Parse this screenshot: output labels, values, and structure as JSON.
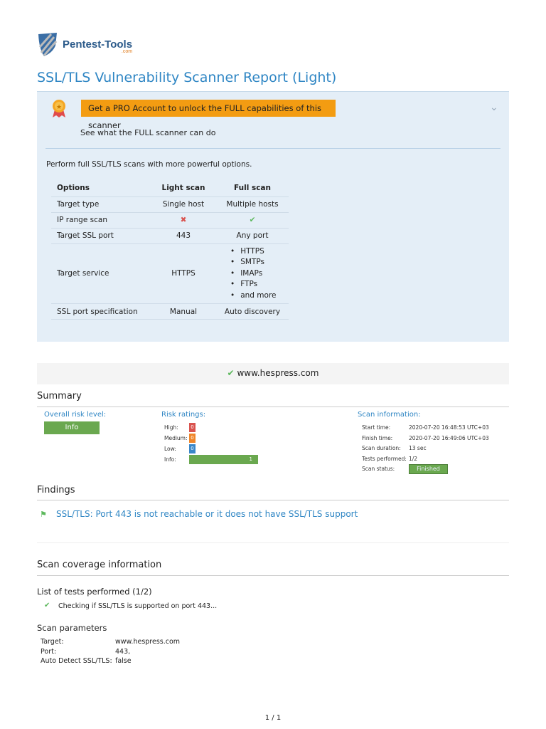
{
  "logo": {
    "name": "Pentest-Tools",
    "suffix": ".com"
  },
  "title": "SSL/TLS Vulnerability Scanner Report (Light)",
  "promo": {
    "button": "Get a PRO Account to unlock the FULL capabilities of this scanner",
    "subtitle": "See what the FULL scanner can do",
    "description": "Perform full SSL/TLS scans with more powerful options.",
    "headers": [
      "Options",
      "Light scan",
      "Full scan"
    ],
    "rows": [
      [
        "Target type",
        "Single host",
        "Multiple hosts"
      ],
      [
        "IP range scan",
        "✖",
        "✔"
      ],
      [
        "Target SSL port",
        "443",
        "Any port"
      ],
      [
        "Target service",
        "HTTPS",
        ""
      ],
      [
        "SSL port specification",
        "Manual",
        "Auto discovery"
      ]
    ],
    "full_services": [
      "HTTPS",
      "SMTPs",
      "IMAPs",
      "FTPs",
      "and more"
    ]
  },
  "target": "www.hespress.com",
  "summary": {
    "heading": "Summary",
    "overall_label": "Overall risk level:",
    "overall_value": "Info",
    "risk_label": "Risk ratings:",
    "risks": [
      {
        "name": "High:",
        "value": "0",
        "color": "#d9534f"
      },
      {
        "name": "Medium:",
        "value": "0",
        "color": "#f0862a"
      },
      {
        "name": "Low:",
        "value": "0",
        "color": "#3a87c8"
      },
      {
        "name": "Info:",
        "value": "1",
        "color": "#6aa84f"
      }
    ],
    "scan_label": "Scan information:",
    "scan": [
      [
        "Start time:",
        "2020-07-20 16:48:53 UTC+03"
      ],
      [
        "Finish time:",
        "2020-07-20 16:49:06 UTC+03"
      ],
      [
        "Scan duration:",
        "13 sec"
      ],
      [
        "Tests performed:",
        "1/2"
      ],
      [
        "Scan status:",
        "Finished"
      ]
    ]
  },
  "findings": {
    "heading": "Findings",
    "items": [
      "SSL/TLS: Port 443 is not reachable or it does not have SSL/TLS support"
    ]
  },
  "coverage": {
    "heading": "Scan coverage information",
    "tests_heading": "List of tests performed (1/2)",
    "tests": [
      "Checking if SSL/TLS is supported on port 443..."
    ],
    "params_heading": "Scan parameters",
    "params": [
      [
        "Target:",
        "www.hespress.com"
      ],
      [
        "Port:",
        "443,"
      ],
      [
        "Auto Detect SSL/TLS:",
        "false"
      ]
    ]
  },
  "page": "1 / 1"
}
